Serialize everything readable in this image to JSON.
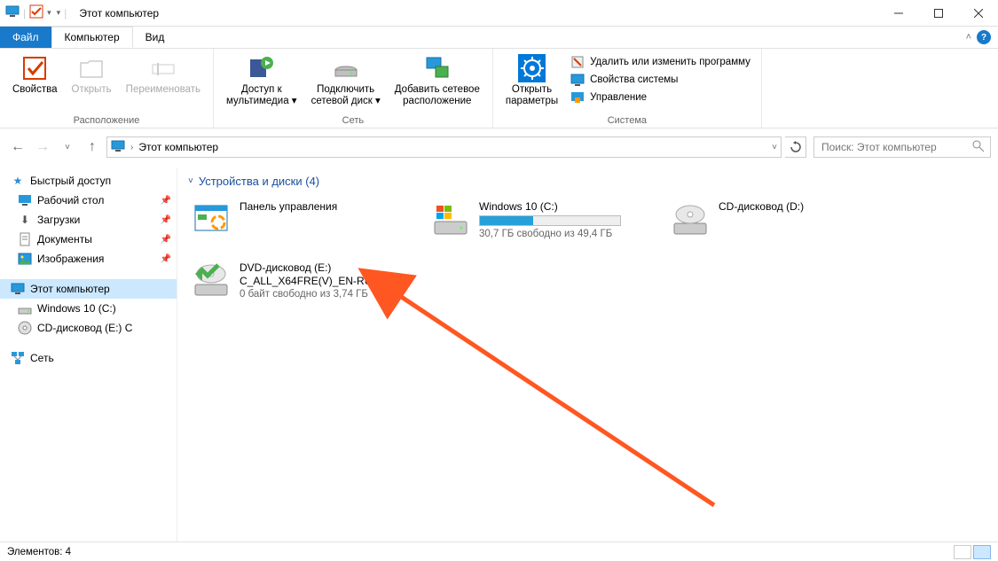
{
  "title": "Этот компьютер",
  "tabs": {
    "file": "Файл",
    "computer": "Компьютер",
    "view": "Вид"
  },
  "ribbon": {
    "location": {
      "properties": "Свойства",
      "open": "Открыть",
      "rename": "Переименовать",
      "group_label": "Расположение"
    },
    "network": {
      "media": "Доступ к\nмультимедиа ▾",
      "map_drive": "Подключить\nсетевой диск ▾",
      "add_net": "Добавить сетевое\nрасположение",
      "group_label": "Сеть"
    },
    "system": {
      "open_settings": "Открыть\nпараметры",
      "uninstall": "Удалить или изменить программу",
      "sys_props": "Свойства системы",
      "manage": "Управление",
      "group_label": "Система"
    }
  },
  "address": {
    "location": "Этот компьютер",
    "search_placeholder": "Поиск: Этот компьютер"
  },
  "sidebar": {
    "quick": "Быстрый доступ",
    "desktop": "Рабочий стол",
    "downloads": "Загрузки",
    "documents": "Документы",
    "pictures": "Изображения",
    "this_pc": "Этот компьютер",
    "windows10": "Windows 10 (C:)",
    "cd_e": "CD-дисковод (E:) C",
    "network": "Сеть"
  },
  "main": {
    "group_header": "Устройства и диски (4)",
    "control_panel": "Панель управления",
    "win10": {
      "name": "Windows 10 (C:)",
      "sub": "30,7 ГБ свободно из 49,4 ГБ",
      "fill_pct": 38
    },
    "cd_d": {
      "name": "CD-дисковод (D:)"
    },
    "dvd_e": {
      "line1": "DVD-дисковод (E:)",
      "line2": "C_ALL_X64FRE(V)_EN-RU_D",
      "sub": "0 байт свободно из 3,74 ГБ"
    }
  },
  "status": {
    "count": "Элементов: 4"
  }
}
